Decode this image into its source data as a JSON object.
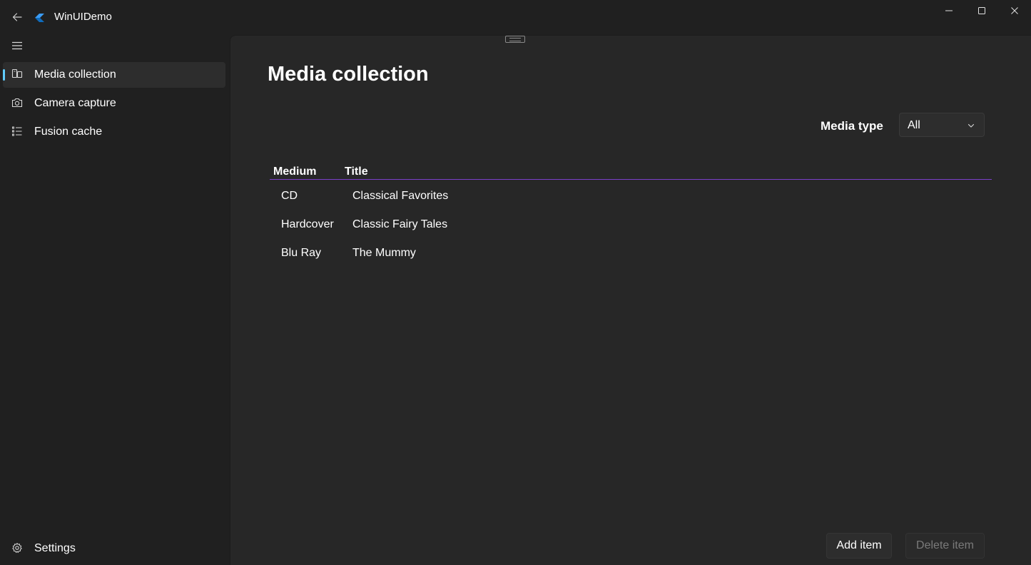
{
  "window": {
    "title": "WinUIDemo"
  },
  "nav": {
    "items": [
      {
        "label": "Media collection",
        "icon": "media-collection-icon",
        "selected": true
      },
      {
        "label": "Camera capture",
        "icon": "camera-icon",
        "selected": false
      },
      {
        "label": "Fusion cache",
        "icon": "list-icon",
        "selected": false
      }
    ],
    "settings": {
      "label": "Settings",
      "icon": "gear-icon"
    }
  },
  "page": {
    "title": "Media collection",
    "filter": {
      "label": "Media type",
      "selected": "All"
    },
    "table": {
      "columns": [
        "Medium",
        "Title"
      ],
      "rows": [
        {
          "medium": "CD",
          "title": "Classical Favorites"
        },
        {
          "medium": "Hardcover",
          "title": "Classic Fairy Tales"
        },
        {
          "medium": "Blu Ray",
          "title": "The Mummy"
        }
      ]
    },
    "buttons": {
      "add": "Add item",
      "delete": "Delete item"
    }
  },
  "colors": {
    "accent": "#60cdff",
    "header_rule": "#7b3fc9",
    "window_bg": "#202020",
    "content_bg": "#272727"
  }
}
